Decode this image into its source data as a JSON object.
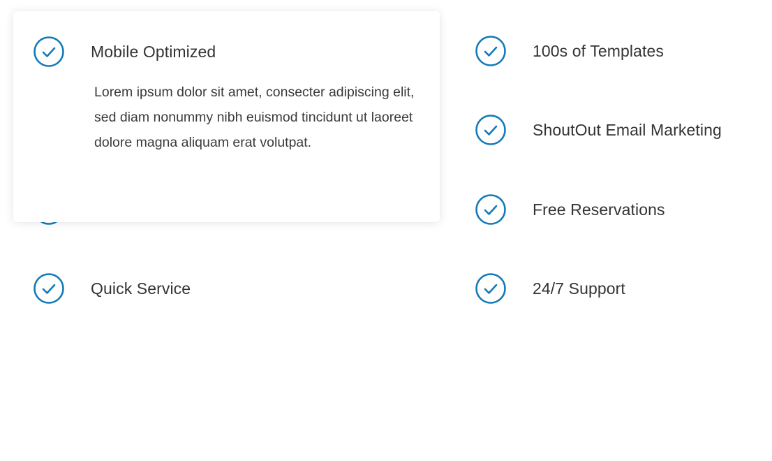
{
  "accent_color": "#1479b8",
  "card": {
    "title": "Mobile Optimized",
    "icon": "check-circle-icon",
    "description": "Lorem ipsum dolor sit amet, consecter adipiscing elit, sed diam nonummy nibh euismod tincidunt ut laoreet dolore magna aliquam erat volutpat."
  },
  "left_features": [
    {
      "label": "Quick Service",
      "icon": "check-circle-icon"
    }
  ],
  "right_features": [
    {
      "label": "100s of Templates",
      "icon": "check-circle-icon"
    },
    {
      "label": "ShoutOut Email Marketing",
      "icon": "check-circle-icon"
    },
    {
      "label": "Free Reservations",
      "icon": "check-circle-icon"
    },
    {
      "label": "24/7 Support",
      "icon": "check-circle-icon"
    }
  ]
}
